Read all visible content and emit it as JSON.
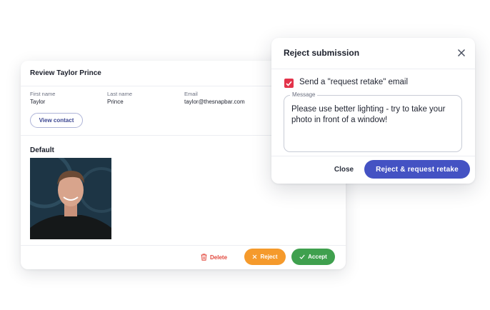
{
  "review": {
    "title": "Review Taylor Prince",
    "fields": {
      "first_name_label": "First name",
      "first_name_value": "Taylor",
      "last_name_label": "Last name",
      "last_name_value": "Prince",
      "email_label": "Email",
      "email_value": "taylor@thesnapbar.com"
    },
    "view_contact_label": "View contact",
    "photo_section_title": "Default",
    "photo_icon": "person-photo",
    "actions": {
      "delete_label": "Delete",
      "delete_icon": "trash-icon",
      "reject_label": "Reject",
      "reject_icon": "x-icon",
      "accept_label": "Accept",
      "accept_icon": "check-icon"
    }
  },
  "modal": {
    "title": "Reject submission",
    "close_icon": "close-icon",
    "checkbox_checked": true,
    "checkbox_label": "Send a \"request retake\" email",
    "message_label": "Message",
    "message_value": "Please use better lighting - try to take your photo in front of a window!",
    "close_label": "Close",
    "submit_label": "Reject & request retake"
  },
  "colors": {
    "primary": "#4452c3",
    "reject": "#f59a2c",
    "accept": "#3fa04e",
    "delete": "#e2483d",
    "checkbox": "#e3334a"
  }
}
